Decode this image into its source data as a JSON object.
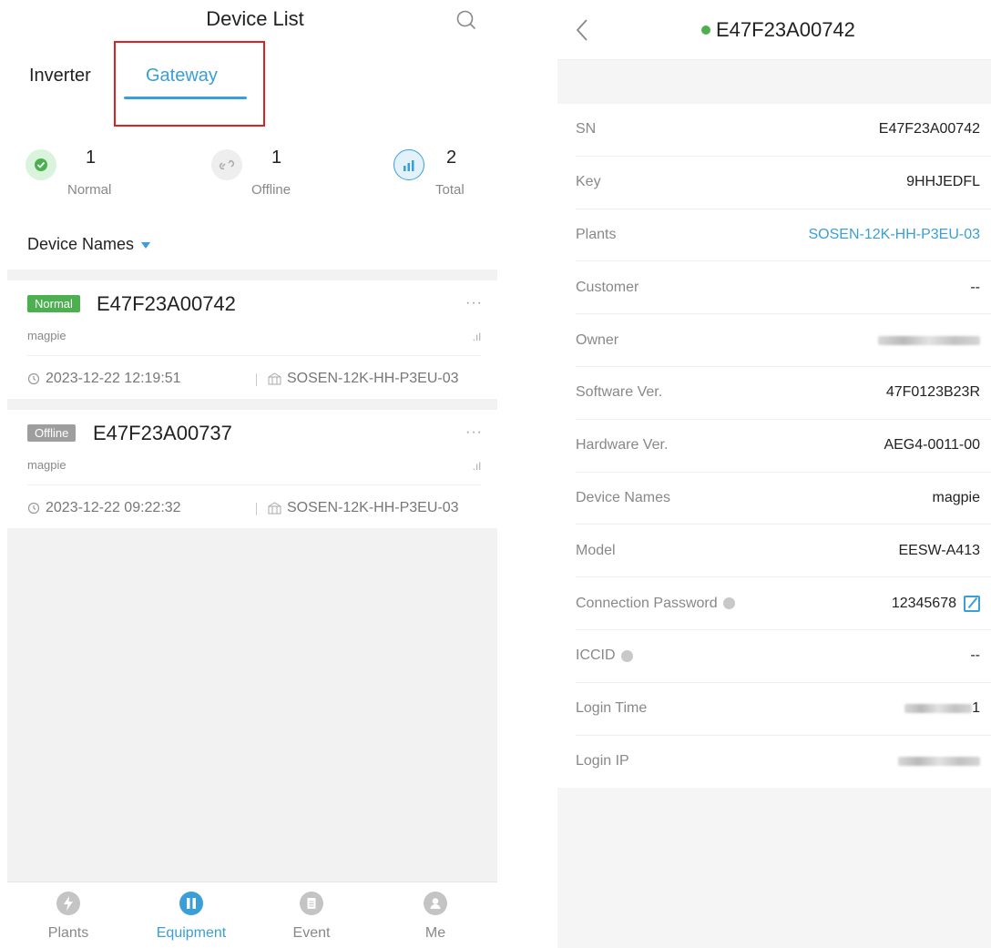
{
  "left": {
    "title": "Device List",
    "tabs": {
      "inverter": "Inverter",
      "gateway": "Gateway"
    },
    "stats": [
      {
        "count": "1",
        "label": "Normal",
        "icon": "check-circle-icon"
      },
      {
        "count": "1",
        "label": "Offline",
        "icon": "link-broken-icon"
      },
      {
        "count": "2",
        "label": "Total",
        "icon": "chart-icon"
      }
    ],
    "filter": "Device Names",
    "devices": [
      {
        "status": "Normal",
        "sn": "E47F23A00742",
        "alias": "magpie",
        "time": "2023-12-22 12:19:51",
        "plant": "SOSEN-12K-HH-P3EU-03",
        "more": "···",
        "signal": ".ıl"
      },
      {
        "status": "Offline",
        "sn": "E47F23A00737",
        "alias": "magpie",
        "time": "2023-12-22 09:22:32",
        "plant": "SOSEN-12K-HH-P3EU-03",
        "more": "···",
        "signal": ".ıl"
      }
    ],
    "nav": [
      {
        "label": "Plants",
        "icon": "lightning-icon"
      },
      {
        "label": "Equipment",
        "icon": "equipment-icon",
        "active": true
      },
      {
        "label": "Event",
        "icon": "clipboard-icon"
      },
      {
        "label": "Me",
        "icon": "person-icon"
      }
    ]
  },
  "right": {
    "title": "E47F23A00742",
    "rows": [
      {
        "label": "SN",
        "value": "E47F23A00742"
      },
      {
        "label": "Key",
        "value": "9HHJEDFL"
      },
      {
        "label": "Plants",
        "value": "SOSEN-12K-HH-P3EU-03"
      },
      {
        "label": "Customer",
        "value": "--"
      },
      {
        "label": "Owner",
        "value": ""
      },
      {
        "label": "Software Ver.",
        "value": "47F0123B23R"
      },
      {
        "label": "Hardware Ver.",
        "value": "AEG4-0011-00"
      },
      {
        "label": "Device Names",
        "value": "magpie"
      },
      {
        "label": "Model",
        "value": "EESW-A413"
      },
      {
        "label": "Connection Password",
        "value": "12345678"
      },
      {
        "label": "ICCID",
        "value": "--"
      },
      {
        "label": "Login Time",
        "value": "1"
      },
      {
        "label": "Login IP",
        "value": ""
      }
    ]
  },
  "colors": {
    "accent": "#3a9fd6",
    "normal": "#4caf50",
    "offline": "#9e9e9e",
    "highlight": "#e02020"
  }
}
